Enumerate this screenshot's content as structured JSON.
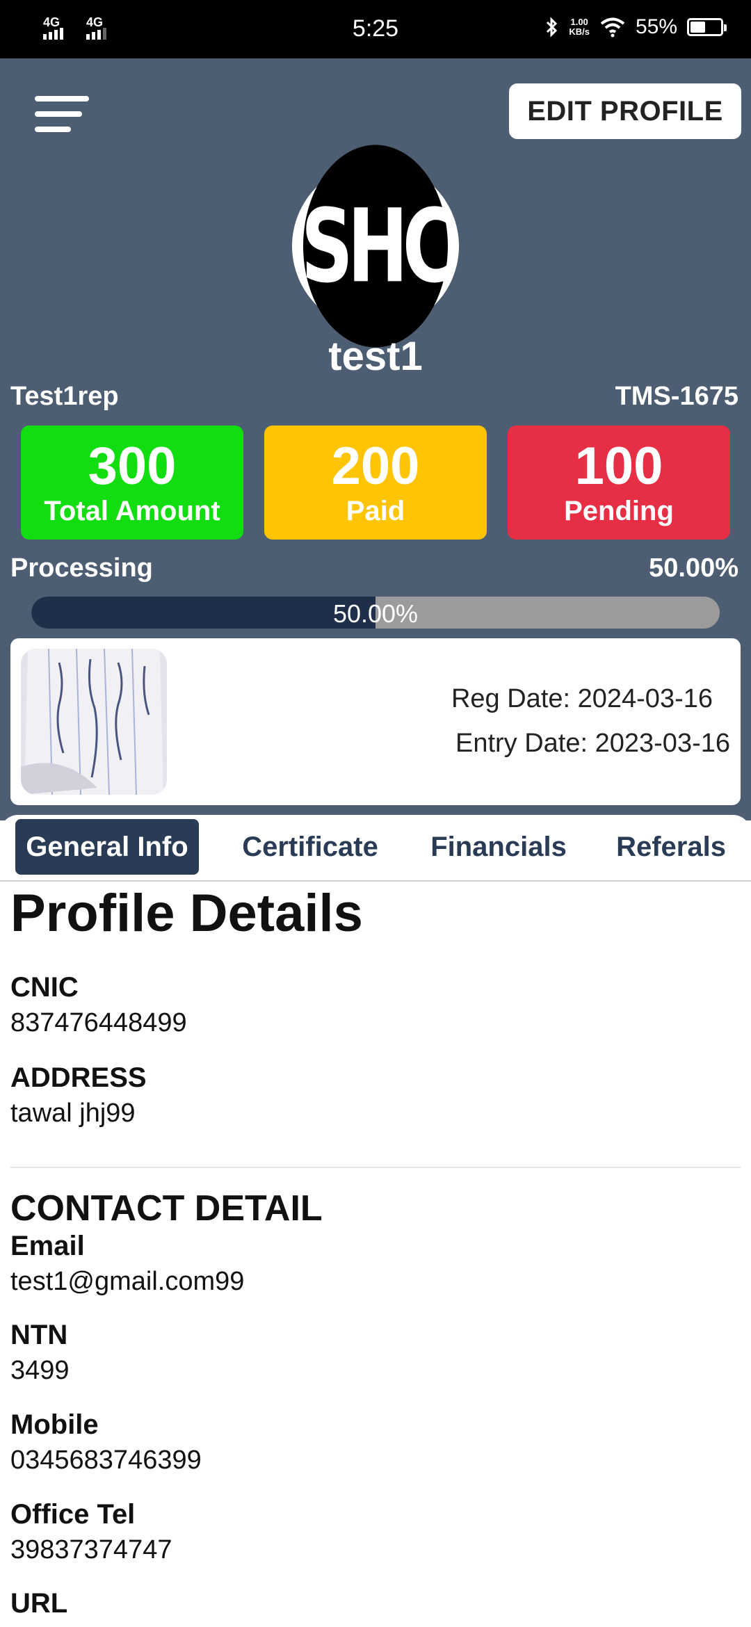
{
  "status_bar": {
    "sim1": "4G",
    "sim2": "4G",
    "time": "5:25",
    "net_speed_top": "1.00",
    "net_speed_unit": "KB/s",
    "battery": "55%",
    "battery_level": 0.55
  },
  "header": {
    "edit_profile_label": "EDIT PROFILE",
    "logo_text": "SHC",
    "username": "test1",
    "ref_name": "Test1rep",
    "tms_id": "TMS-1675"
  },
  "stats": [
    {
      "value": "300",
      "label": "Total Amount",
      "color": "#11dd11"
    },
    {
      "value": "200",
      "label": "Paid",
      "color": "#ffc403"
    },
    {
      "value": "100",
      "label": "Pending",
      "color": "#e62e45"
    }
  ],
  "processing": {
    "label": "Processing",
    "value_text": "50.00%",
    "progress": 0.5,
    "bar_text": "50.00%"
  },
  "registration": {
    "reg_date": "Reg Date: 2024-03-16",
    "entry_date": "Entry Date: 2023-03-16"
  },
  "tabs": [
    {
      "label": "General Info",
      "active": true
    },
    {
      "label": "Certificate",
      "active": false
    },
    {
      "label": "Financials",
      "active": false
    },
    {
      "label": "Referals",
      "active": false
    }
  ],
  "profile": {
    "title": "Profile Details",
    "cnic_label": "CNIC",
    "cnic_value": "837476448499",
    "address_label": "ADDRESS",
    "address_value": "tawal jhj99"
  },
  "contact": {
    "title": "CONTACT DETAIL",
    "email_label": "Email",
    "email_value": "test1@gmail.com99",
    "ntn_label": "NTN",
    "ntn_value": "3499",
    "mobile_label": "Mobile",
    "mobile_value": "0345683746399",
    "office_label": "Office Tel",
    "office_value": "39837374747",
    "url_label": "URL"
  },
  "colors": {
    "header_bg": "#4e5e72",
    "accent_dark": "#2a3b55",
    "progress_fill": "#1f2f4a"
  }
}
